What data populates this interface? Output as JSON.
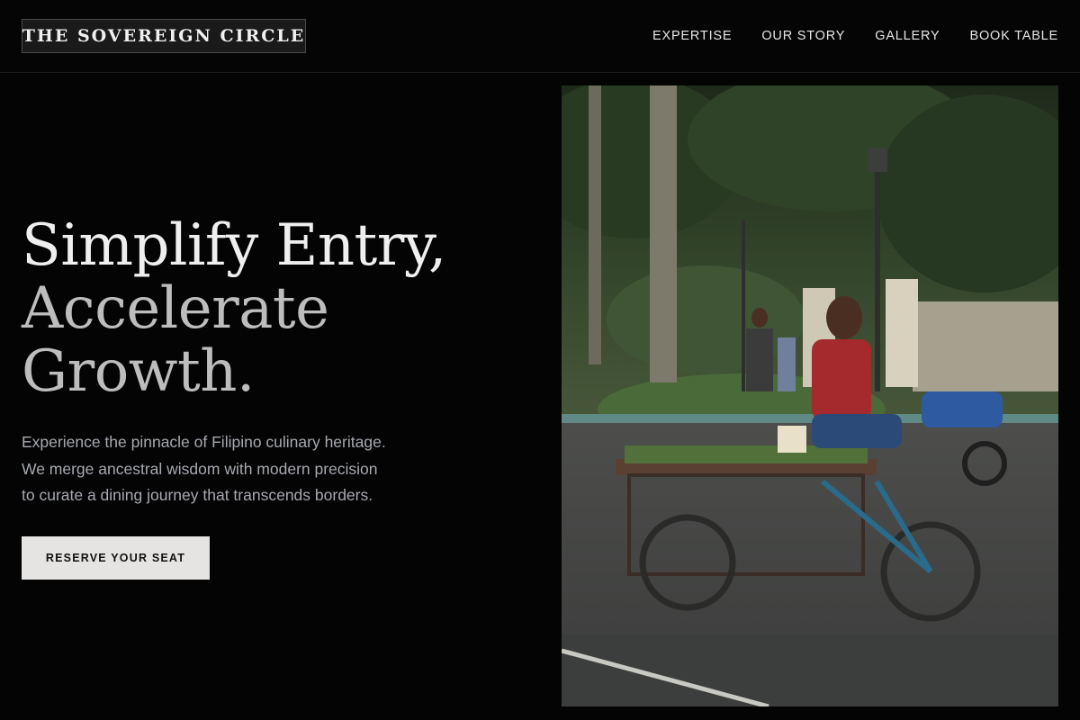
{
  "brand": {
    "name": "THE SOVEREIGN CIRCLE"
  },
  "nav": {
    "items": [
      {
        "label": "EXPERTISE"
      },
      {
        "label": "OUR STORY"
      },
      {
        "label": "GALLERY"
      },
      {
        "label": "BOOK TABLE"
      }
    ]
  },
  "hero": {
    "title_lines": [
      "Simplify Entry,",
      "Accelerate",
      "Growth."
    ],
    "description_lines": [
      "Experience the pinnacle of Filipino culinary heritage.",
      "We merge ancestral wisdom with modern precision",
      "to curate a dining journey that transcends borders."
    ],
    "cta_label": "RESERVE YOUR SEAT"
  },
  "image": {
    "subject": "street-vendor-tricycle-photo"
  },
  "colors": {
    "background": "#040404",
    "cta_background": "#e6e4e2",
    "title_primary": "#efefef",
    "title_secondary": "#bdbdbd",
    "body_text": "#a7a9b1"
  }
}
